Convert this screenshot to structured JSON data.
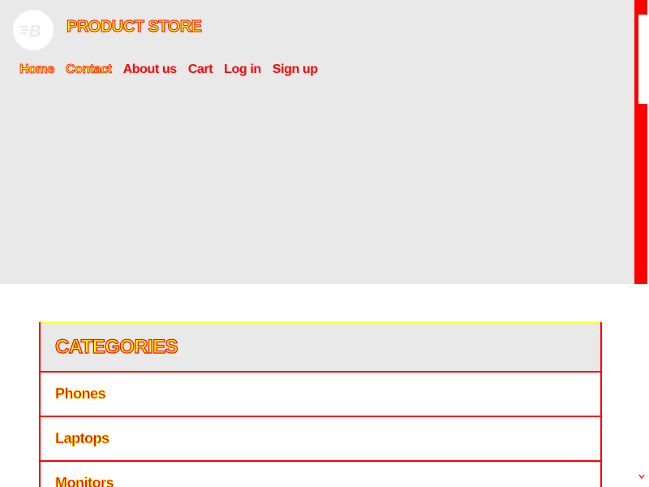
{
  "header": {
    "brand": "PRODUCT STORE",
    "logo_letter": "B"
  },
  "nav": {
    "items": [
      {
        "label": "Home"
      },
      {
        "label": "Contact"
      },
      {
        "label": "About us"
      },
      {
        "label": "Cart"
      },
      {
        "label": "Log in"
      },
      {
        "label": "Sign up"
      }
    ]
  },
  "categories": {
    "title": "CATEGORIES",
    "items": [
      {
        "label": "Phones"
      },
      {
        "label": "Laptops"
      },
      {
        "label": "Monitors"
      }
    ]
  },
  "icons": {
    "logo": "bootstrap-logo-icon",
    "scroll_up": "arrow-up-icon",
    "scroll_down": "arrow-down-icon"
  },
  "colors": {
    "hero_background": "#e9e9e9",
    "accent_red": "#ff0000",
    "accent_yellow": "#ffff00"
  }
}
